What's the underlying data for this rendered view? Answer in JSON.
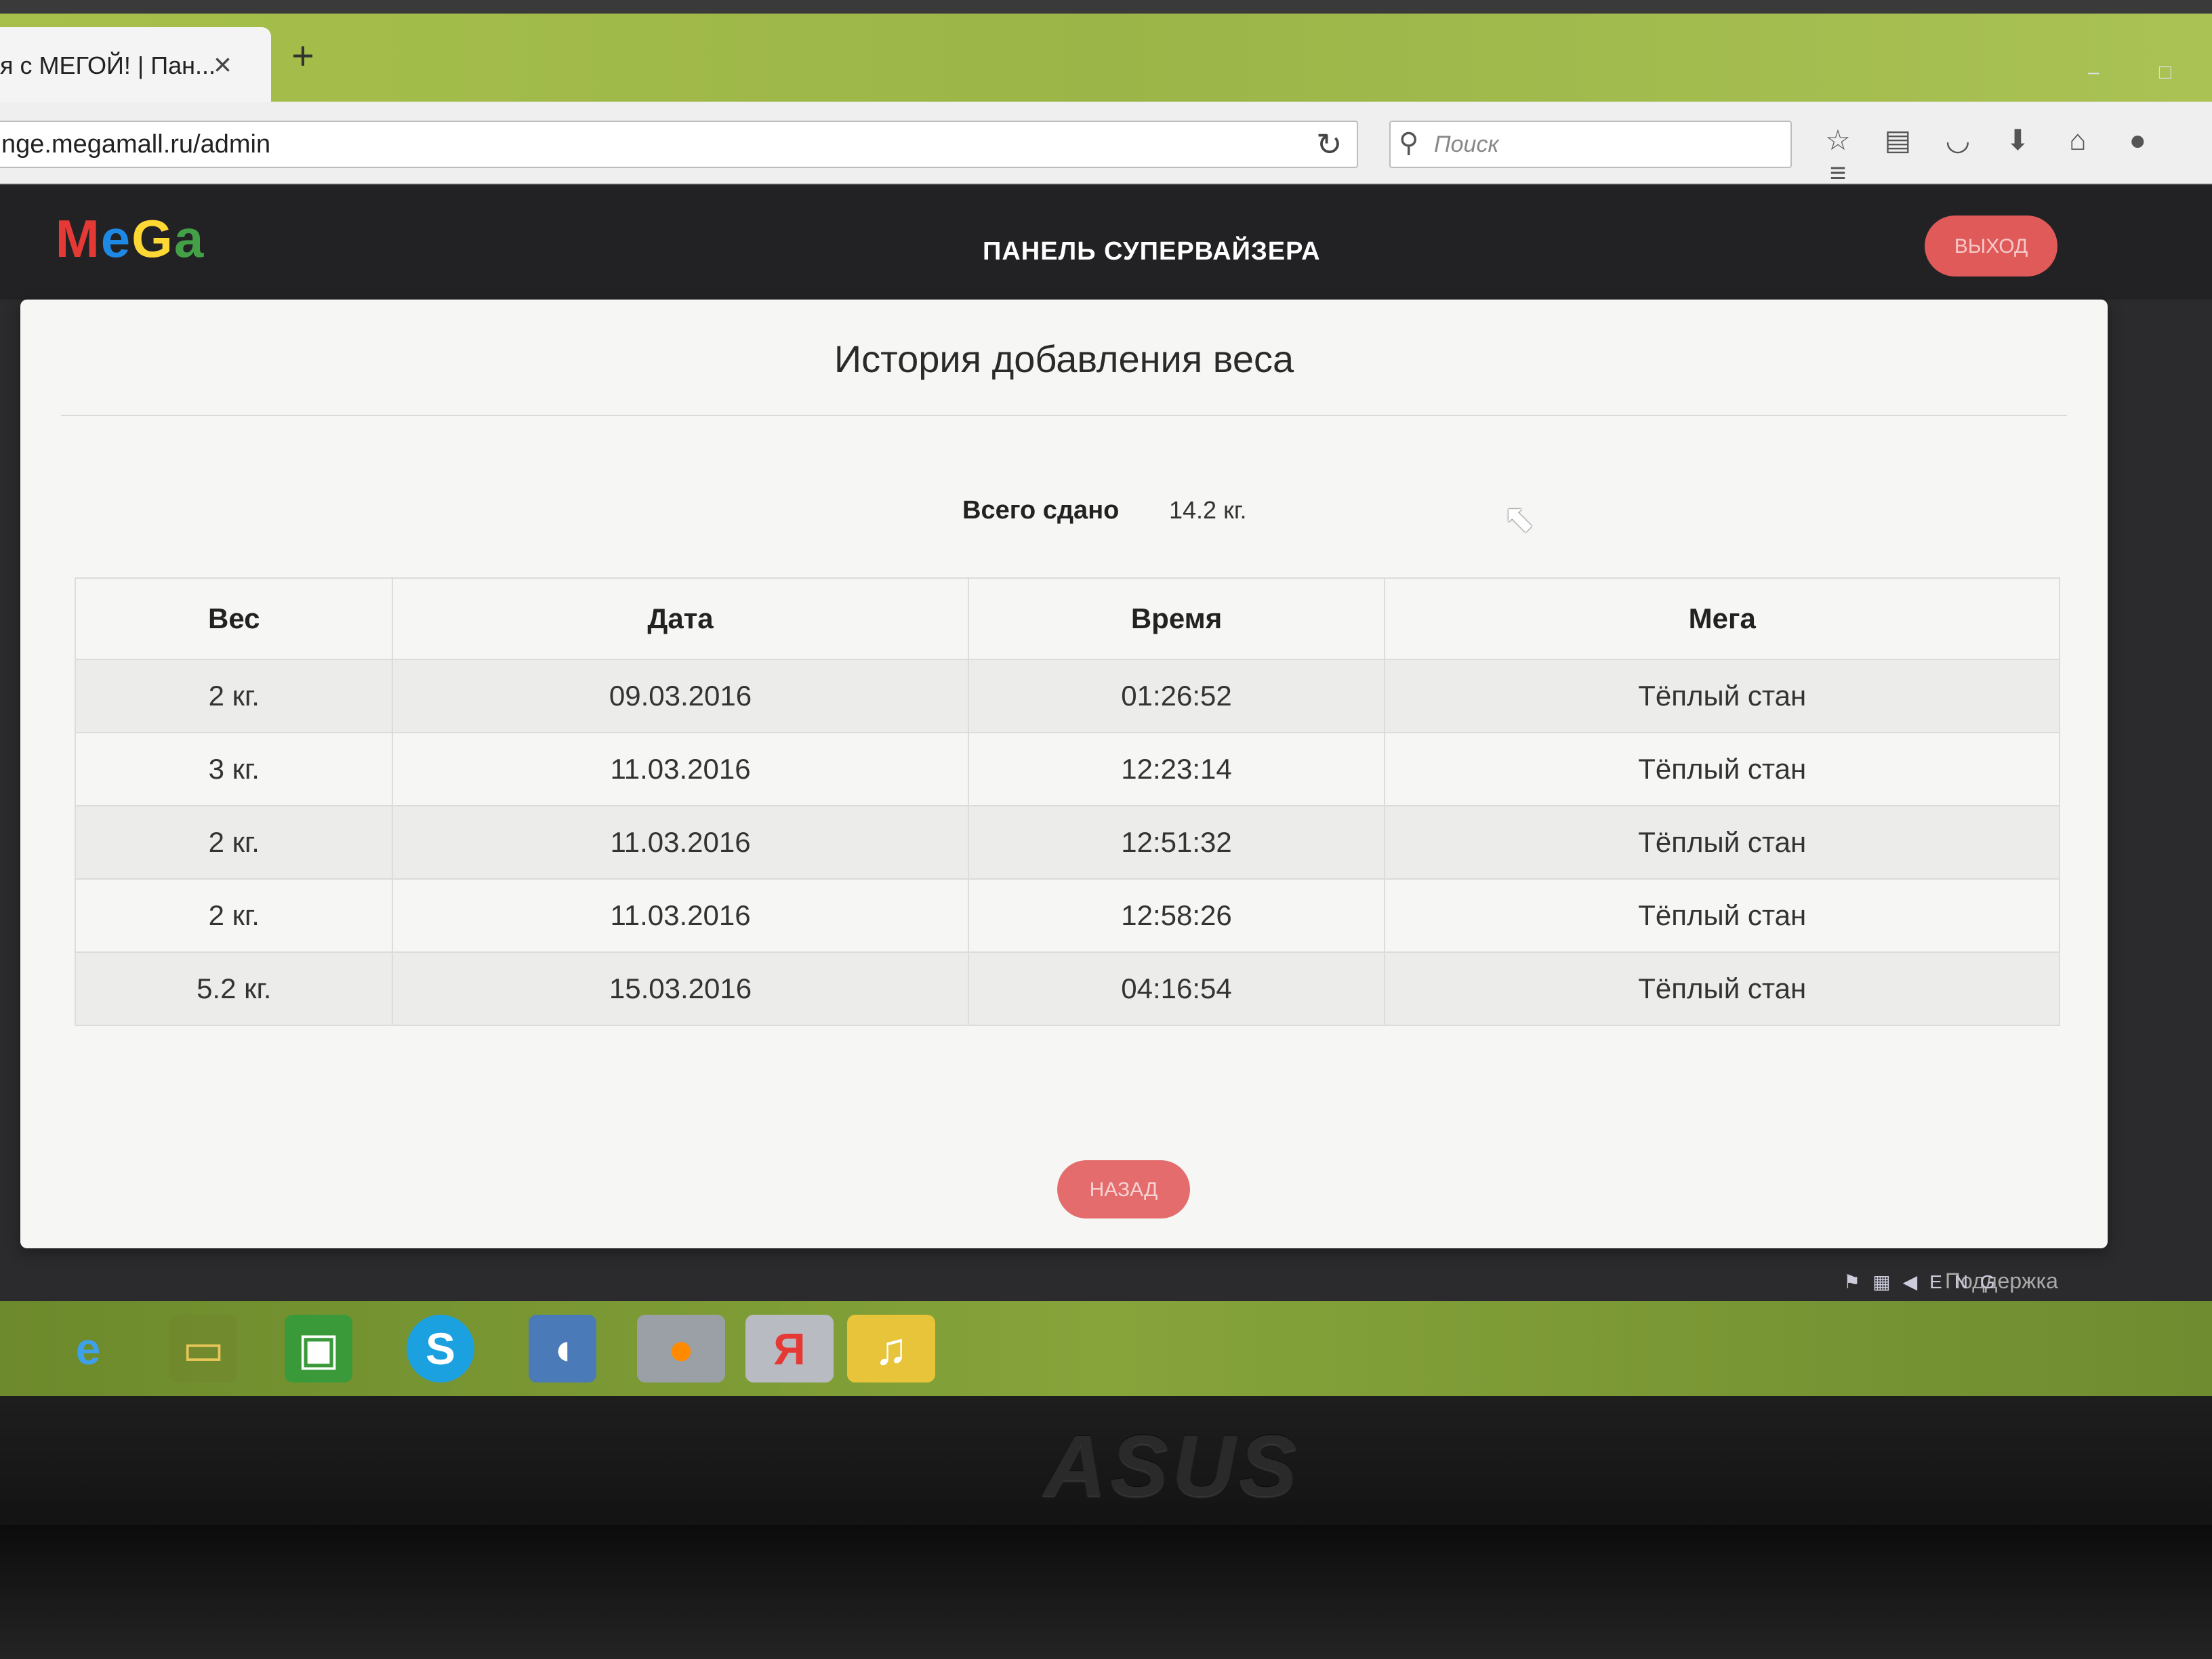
{
  "browser": {
    "tab_title": "я с МЕГОЙ! | Пан...",
    "tab_close_icon": "×",
    "new_tab_icon": "+",
    "url": "nge.megamall.ru/admin",
    "search_placeholder": "Поиск"
  },
  "header": {
    "logo_letters": [
      "M",
      "e",
      "G",
      "a"
    ],
    "title": "ПАНЕЛЬ СУПЕРВАЙЗЕРА",
    "logout_label": "ВЫХОД"
  },
  "main": {
    "heading": "История добавления веса",
    "total_label": "Всего сдано",
    "total_value": "14.2 кг.",
    "table": {
      "columns": [
        "Вес",
        "Дата",
        "Время",
        "Мега"
      ],
      "rows": [
        [
          "2 кг.",
          "09.03.2016",
          "01:26:52",
          "Тёплый стан"
        ],
        [
          "3 кг.",
          "11.03.2016",
          "12:23:14",
          "Тёплый стан"
        ],
        [
          "2 кг.",
          "11.03.2016",
          "12:51:32",
          "Тёплый стан"
        ],
        [
          "2 кг.",
          "11.03.2016",
          "12:58:26",
          "Тёплый стан"
        ],
        [
          "5.2 кг.",
          "15.03.2016",
          "04:16:54",
          "Тёплый стан"
        ]
      ]
    },
    "back_label": "НАЗАД"
  },
  "footer": {
    "support_label": "Поддержка"
  },
  "taskbar": {
    "yandex_letter": "Я",
    "skype_letter": "S",
    "tray_lang": "ENG"
  },
  "laptop": {
    "brand": "ASUS"
  },
  "colors": {
    "accent": "#e05a5a",
    "tab_green": "#a7c04b",
    "header_bg": "#222224"
  }
}
